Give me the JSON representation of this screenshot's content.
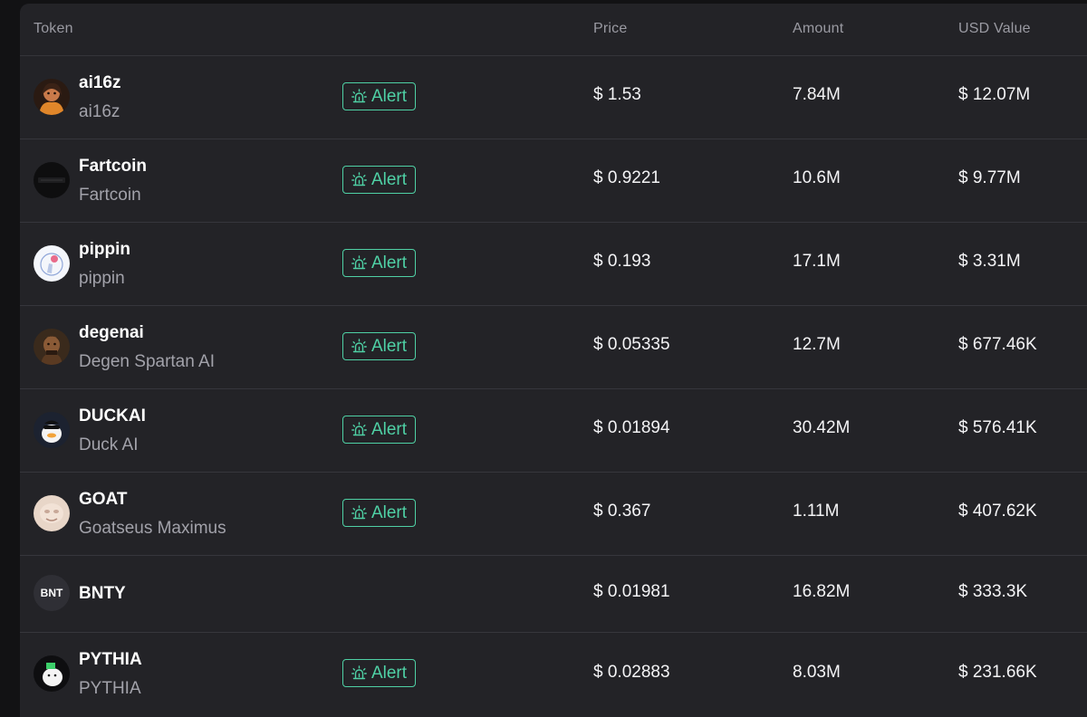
{
  "header": {
    "token": "Token",
    "price": "Price",
    "amount": "Amount",
    "usd_value": "USD Value"
  },
  "alert_label": "Alert",
  "accent_color": "#4fd1a5",
  "tokens": [
    {
      "symbol": "ai16z",
      "name": "ai16z",
      "price": "$ 1.53",
      "amount": "7.84M",
      "usd_value": "$ 12.07M",
      "has_alert": true,
      "icon": "ai16z-avatar-icon"
    },
    {
      "symbol": "Fartcoin",
      "name": "Fartcoin",
      "price": "$ 0.9221",
      "amount": "10.6M",
      "usd_value": "$ 9.77M",
      "has_alert": true,
      "icon": "fartcoin-avatar-icon"
    },
    {
      "symbol": "pippin",
      "name": "pippin",
      "price": "$ 0.193",
      "amount": "17.1M",
      "usd_value": "$ 3.31M",
      "has_alert": true,
      "icon": "pippin-avatar-icon"
    },
    {
      "symbol": "degenai",
      "name": "Degen Spartan AI",
      "price": "$ 0.05335",
      "amount": "12.7M",
      "usd_value": "$ 677.46K",
      "has_alert": true,
      "icon": "degenai-avatar-icon"
    },
    {
      "symbol": "DUCKAI",
      "name": "Duck AI",
      "price": "$ 0.01894",
      "amount": "30.42M",
      "usd_value": "$ 576.41K",
      "has_alert": true,
      "icon": "duck-avatar-icon"
    },
    {
      "symbol": "GOAT",
      "name": "Goatseus Maximus",
      "price": "$ 0.367",
      "amount": "1.11M",
      "usd_value": "$ 407.62K",
      "has_alert": true,
      "icon": "goat-avatar-icon"
    },
    {
      "symbol": "BNTY",
      "avatar_text": "BNT",
      "price": "$ 0.01981",
      "amount": "16.82M",
      "usd_value": "$ 333.3K",
      "has_alert": false,
      "icon": "bnt-avatar-icon"
    },
    {
      "symbol": "PYTHIA",
      "name": "PYTHIA",
      "price": "$ 0.02883",
      "amount": "8.03M",
      "usd_value": "$ 231.66K",
      "has_alert": true,
      "icon": "pythia-avatar-icon"
    }
  ]
}
